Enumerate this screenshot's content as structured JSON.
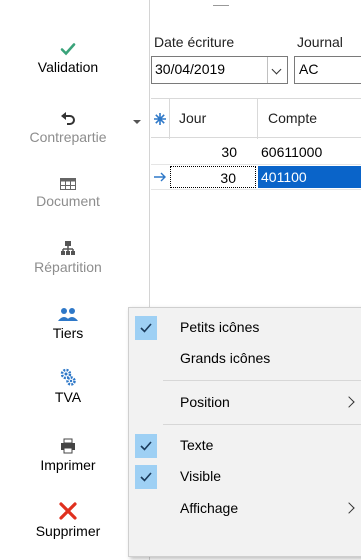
{
  "toolbar": {
    "items": [
      {
        "label": "Validation",
        "icon": "checkmark-icon",
        "enabled": true
      },
      {
        "label": "Contrepartie",
        "icon": "undo-arrow-icon",
        "enabled": false
      },
      {
        "label": "Document",
        "icon": "table-grid-icon",
        "enabled": false
      },
      {
        "label": "Répartition",
        "icon": "org-chart-icon",
        "enabled": false
      },
      {
        "label": "Tiers",
        "icon": "people-icon",
        "enabled": true
      },
      {
        "label": "TVA",
        "icon": "gears-icon",
        "enabled": true
      },
      {
        "label": "Imprimer",
        "icon": "printer-icon",
        "enabled": true
      },
      {
        "label": "Supprimer",
        "icon": "red-x-icon",
        "enabled": true
      }
    ]
  },
  "form": {
    "date_label": "Date écriture",
    "date_value": "30/04/2019",
    "journal_label": "Journal",
    "journal_value": "AC"
  },
  "grid": {
    "headers": {
      "jour": "Jour",
      "compte": "Compte"
    },
    "rows": [
      {
        "jour": "30",
        "compte": "60611000",
        "selected": false
      },
      {
        "jour": "30",
        "compte": "401100",
        "selected": true
      }
    ]
  },
  "context_menu": {
    "items": [
      {
        "label": "Petits icônes",
        "checked": true,
        "submenu": false
      },
      {
        "label": "Grands icônes",
        "checked": false,
        "submenu": false
      },
      {
        "label": "Position",
        "checked": false,
        "submenu": true
      },
      {
        "label": "Texte",
        "checked": true,
        "submenu": false
      },
      {
        "label": "Visible",
        "checked": true,
        "submenu": false
      },
      {
        "label": "Affichage",
        "checked": false,
        "submenu": true
      }
    ]
  },
  "colors": {
    "selection": "#0a64c9",
    "menu_check_bg": "#9ed0f4",
    "check_green": "#3aa37a",
    "delete_red": "#e0301e",
    "icon_blue": "#2e78c8"
  }
}
